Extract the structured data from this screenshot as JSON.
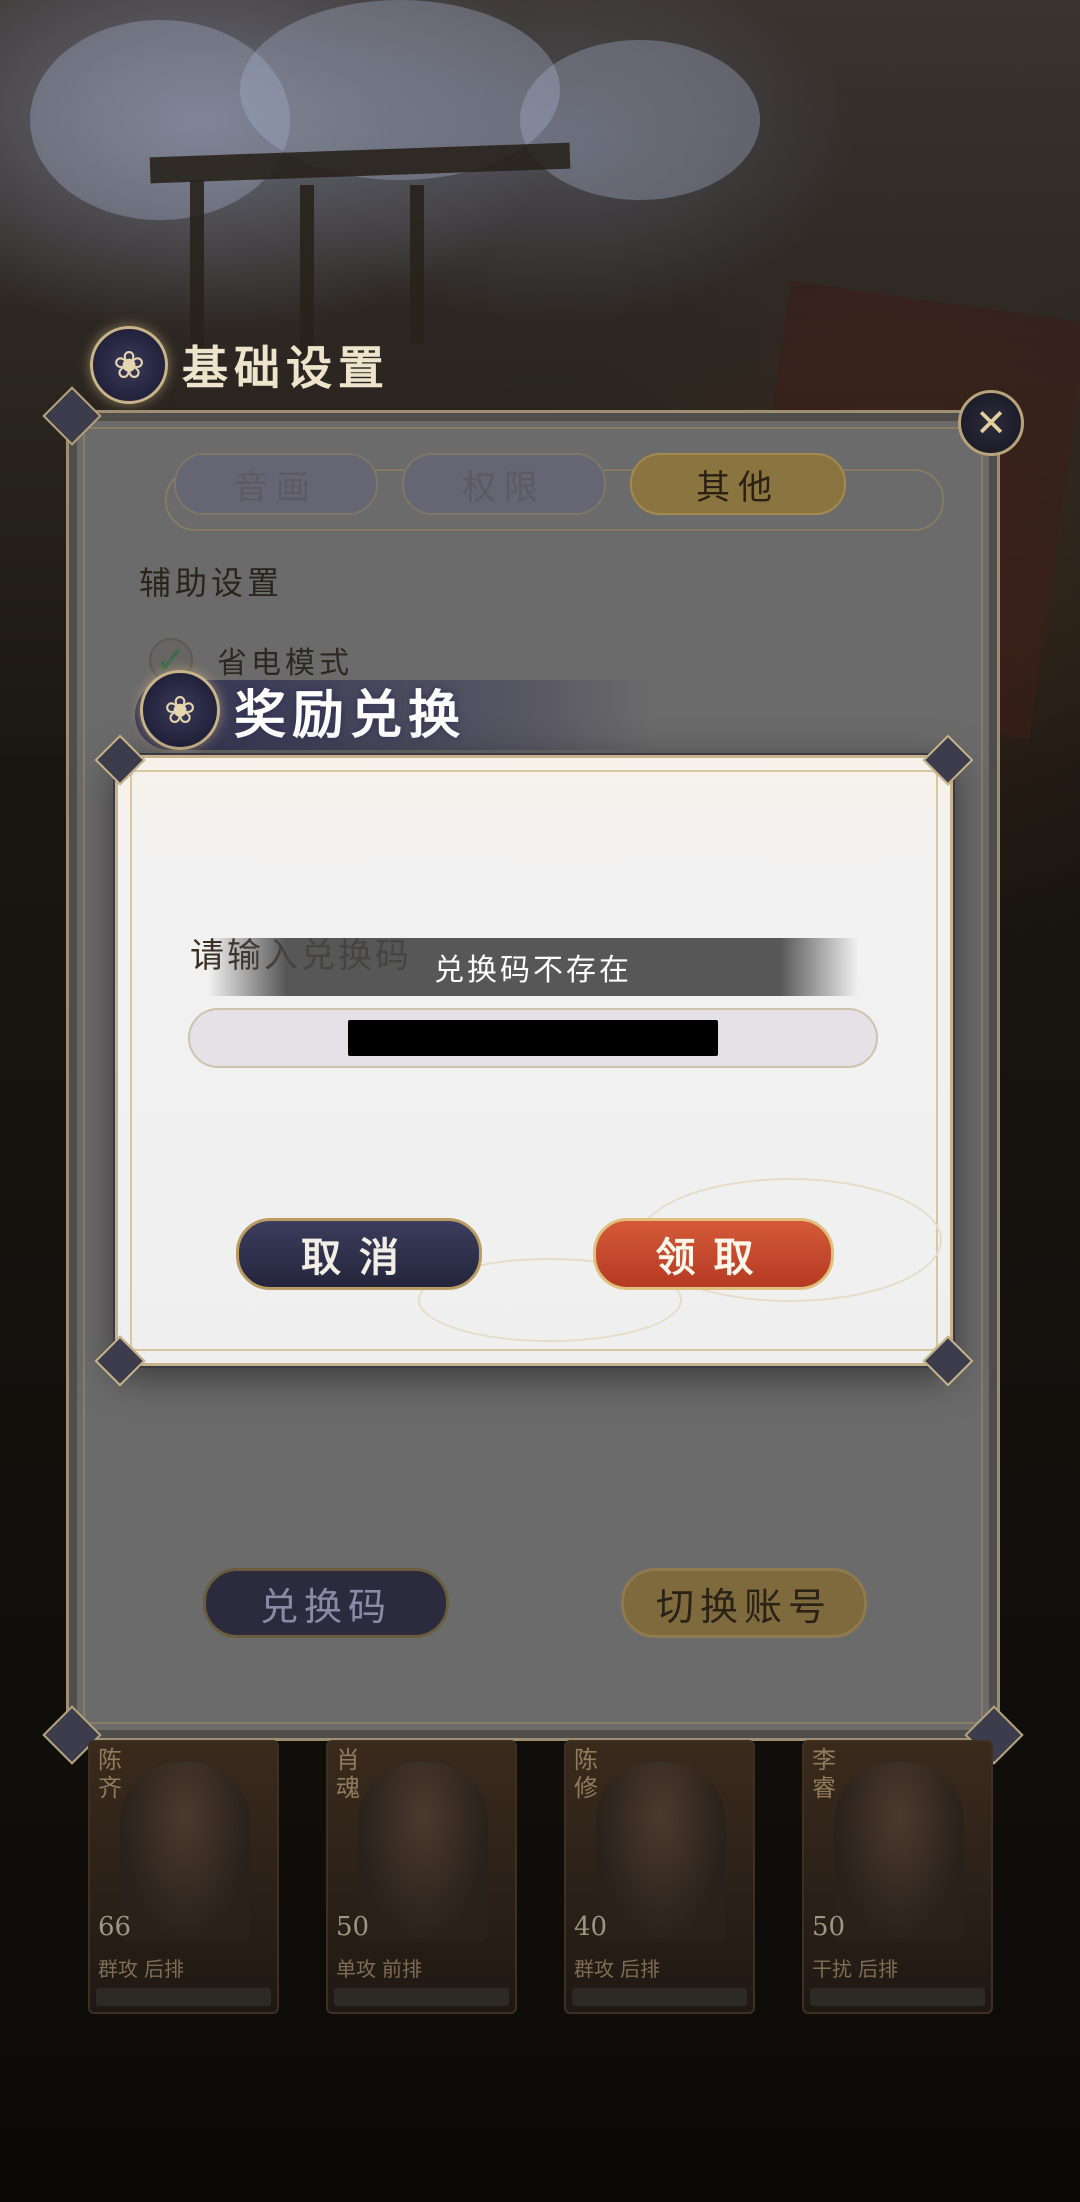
{
  "base_settings": {
    "title": "基础设置",
    "tabs": [
      {
        "label": "音画",
        "active": false
      },
      {
        "label": "权限",
        "active": false
      },
      {
        "label": "其他",
        "active": true
      }
    ],
    "section_label": "辅助设置",
    "power_saving": {
      "label": "省电模式",
      "checked": true
    },
    "redeem_code_button": "兑换码",
    "switch_account_button": "切换账号"
  },
  "characters": [
    {
      "name": "陈齐",
      "level": "66",
      "tags": [
        "群攻",
        "后排"
      ]
    },
    {
      "name": "肖魂",
      "level": "50",
      "tags": [
        "单攻",
        "前排"
      ]
    },
    {
      "name": "陈修",
      "level": "40",
      "tags": [
        "群攻",
        "后排"
      ]
    },
    {
      "name": "李睿",
      "level": "50",
      "tags": [
        "干扰",
        "后排"
      ]
    }
  ],
  "reward_dialog": {
    "title": "奖励兑换",
    "prompt": "请输入兑换码",
    "toast": "兑换码不存在",
    "input_value_redacted": true,
    "cancel_button": "取消",
    "claim_button": "领取"
  },
  "icons": {
    "close": "close-icon",
    "emblem": "emblem-icon",
    "check": "check-icon"
  },
  "colors": {
    "claim_button": "#c94a2e",
    "cancel_button": "#2f3050",
    "gold_accent": "#c9b48a"
  }
}
